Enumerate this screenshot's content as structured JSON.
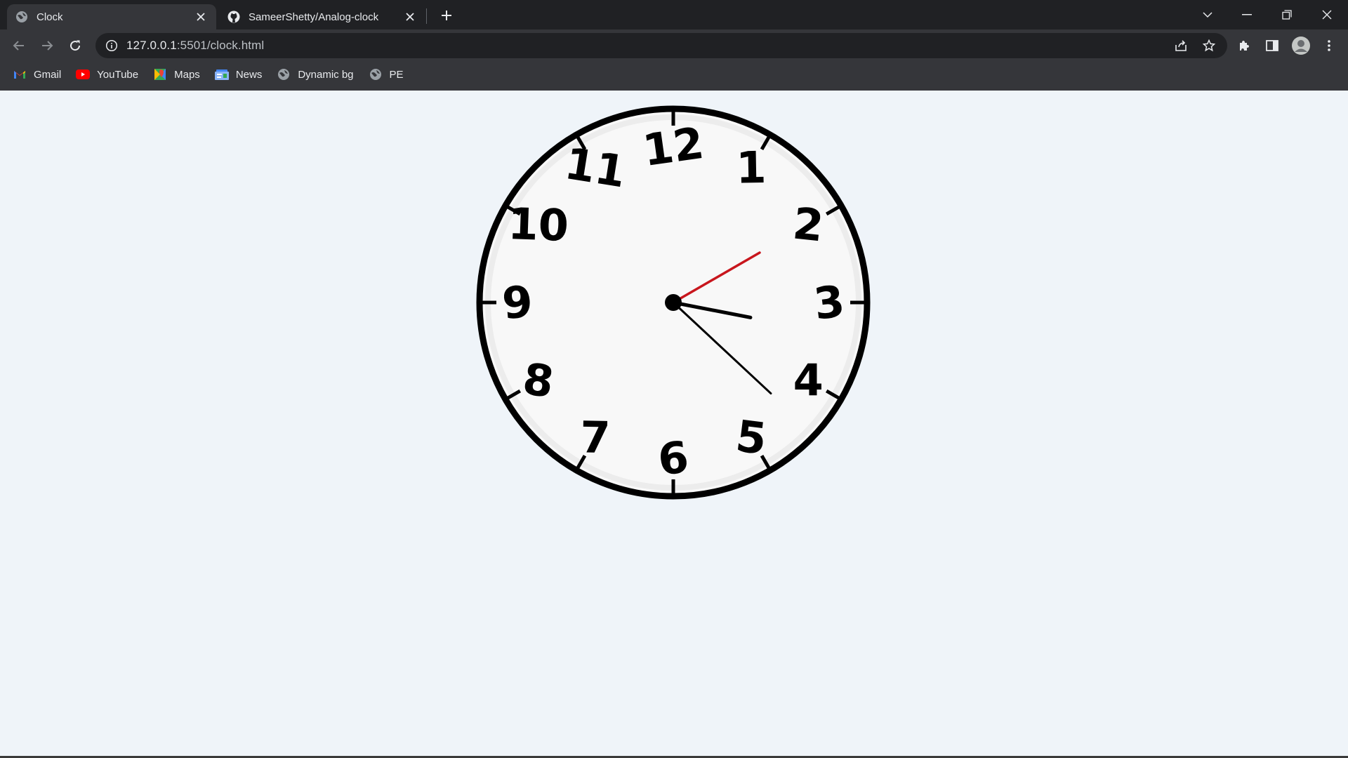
{
  "tabs": [
    {
      "title": "Clock",
      "favicon": "globe-icon",
      "active": true
    },
    {
      "title": "SameerShetty/Analog-clock",
      "favicon": "github-icon",
      "active": false
    }
  ],
  "address_bar": {
    "host": "127.0.0.1",
    "path": ":5501/clock.html"
  },
  "bookmarks": [
    {
      "label": "Gmail",
      "icon": "gmail-icon"
    },
    {
      "label": "YouTube",
      "icon": "youtube-icon"
    },
    {
      "label": "Maps",
      "icon": "maps-icon"
    },
    {
      "label": "News",
      "icon": "news-icon"
    },
    {
      "label": "Dynamic bg",
      "icon": "globe-icon"
    },
    {
      "label": "PE",
      "icon": "globe-icon"
    }
  ],
  "clock": {
    "numerals": [
      "12",
      "1",
      "2",
      "3",
      "4",
      "5",
      "6",
      "7",
      "8",
      "9",
      "10",
      "11"
    ],
    "time": {
      "hour": 3,
      "minute": 22,
      "second": 10
    },
    "colors": {
      "face": "#f8f8f8",
      "rim": "#000000",
      "second_hand": "#c8161d",
      "hands": "#000000",
      "page_bg": "#eff4f9"
    }
  }
}
